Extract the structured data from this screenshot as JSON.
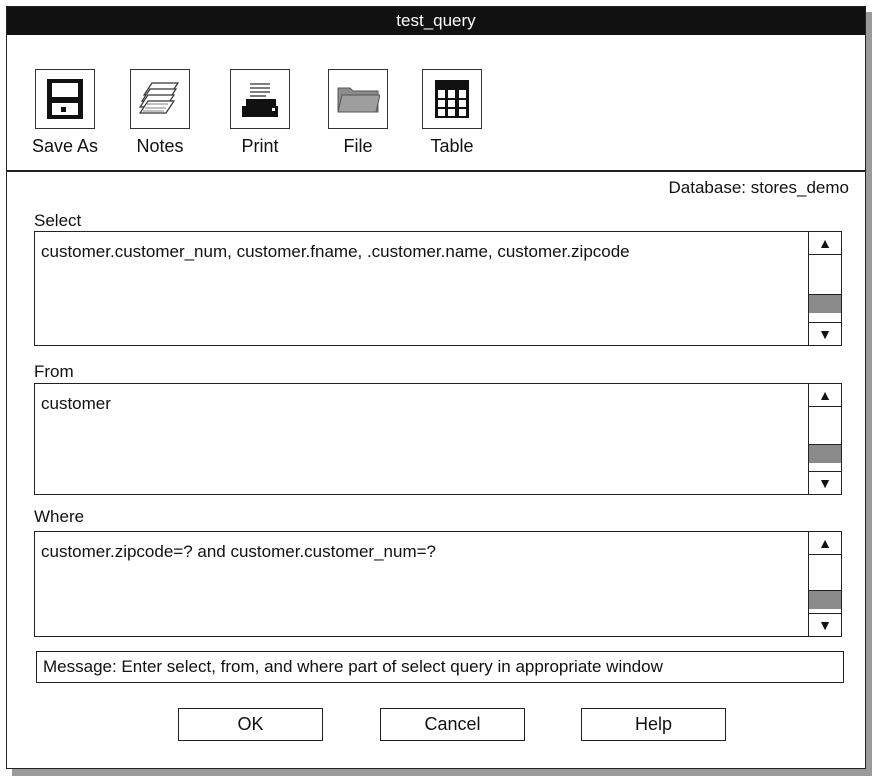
{
  "window": {
    "title": "test_query"
  },
  "toolbar": {
    "items": [
      {
        "label": "Save As",
        "icon": "floppy-disk-icon"
      },
      {
        "label": "Notes",
        "icon": "notes-stack-icon"
      },
      {
        "label": "Print",
        "icon": "printer-icon"
      },
      {
        "label": "File",
        "icon": "folder-icon"
      },
      {
        "label": "Table",
        "icon": "table-icon"
      }
    ]
  },
  "database": {
    "text": "Database: stores_demo"
  },
  "select": {
    "label": "Select",
    "value": "customer.customer_num, customer.fname, .customer.name, customer.zipcode"
  },
  "from": {
    "label": "From",
    "value": "customer"
  },
  "where": {
    "label": "Where",
    "value": "customer.zipcode=? and customer.customer_num=?"
  },
  "message": {
    "text": "Message: Enter select, from, and where part of select query in appropriate window"
  },
  "buttons": {
    "ok": "OK",
    "cancel": "Cancel",
    "help": "Help"
  }
}
